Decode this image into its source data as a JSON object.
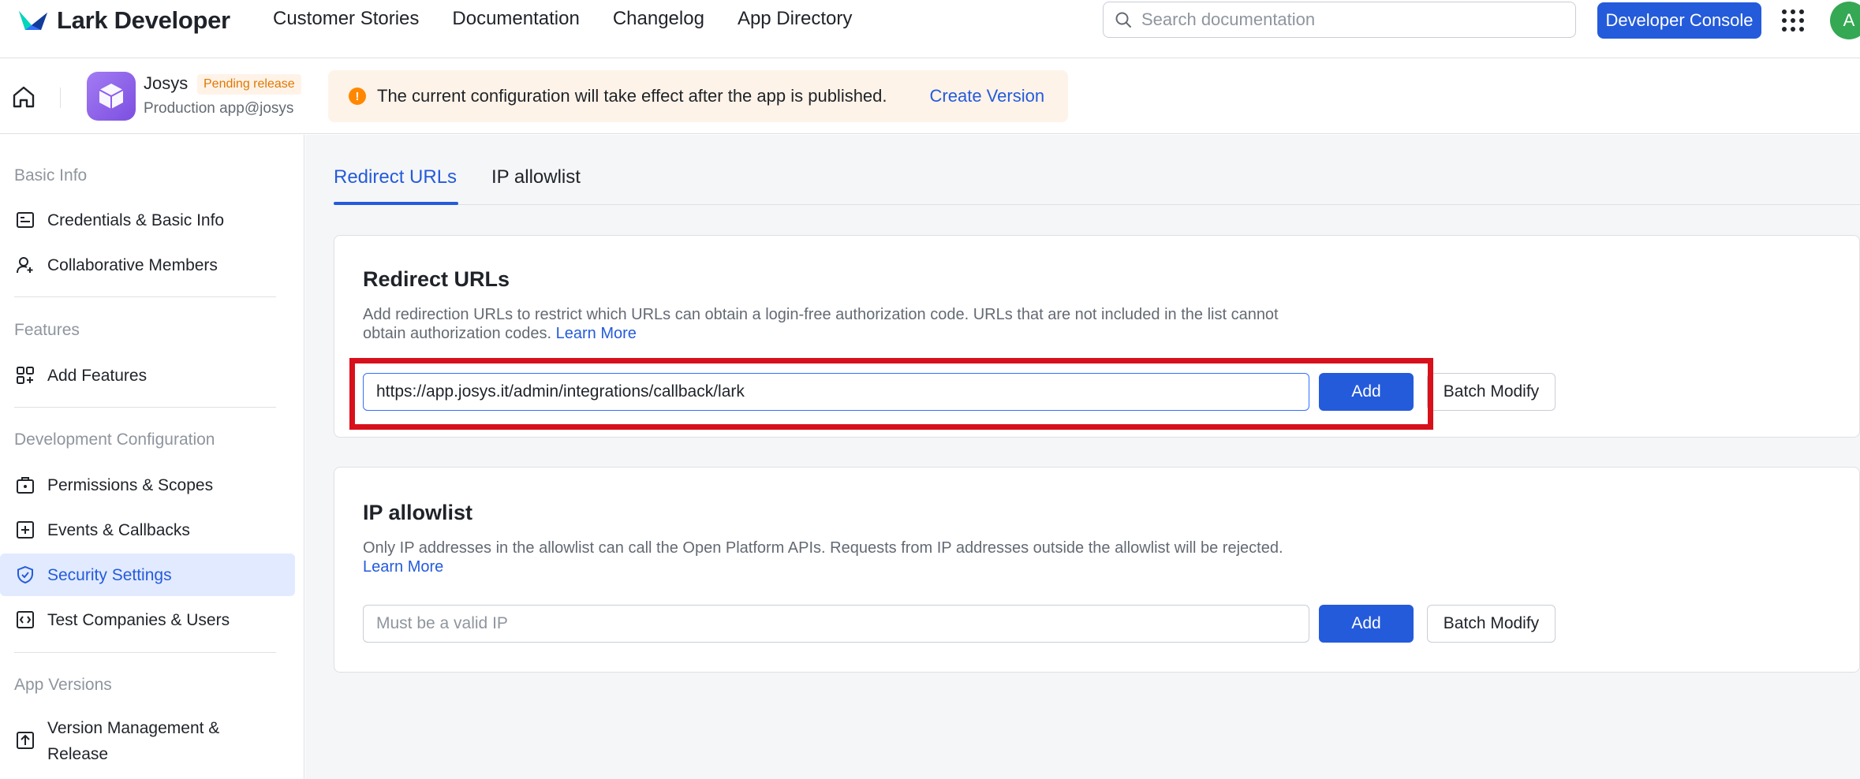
{
  "brand": {
    "name": "Lark Developer",
    "icon": "lark-logo-icon"
  },
  "nav": {
    "links": [
      "Customer Stories",
      "Documentation",
      "Changelog",
      "App Directory"
    ],
    "search_placeholder": "Search documentation",
    "developer_console": "Developer Console",
    "avatar_initial": "A"
  },
  "app": {
    "name": "Josys",
    "status": "Pending release",
    "subtitle": "Production app@josys",
    "notice": "The current configuration will take effect after the app is published.",
    "notice_action": "Create Version"
  },
  "sidebar": {
    "sections": [
      {
        "title": "Basic Info",
        "items": [
          {
            "label": "Credentials & Basic Info",
            "icon": "credentials-icon"
          },
          {
            "label": "Collaborative Members",
            "icon": "add-member-icon"
          }
        ]
      },
      {
        "title": "Features",
        "items": [
          {
            "label": "Add Features",
            "icon": "add-features-icon"
          }
        ]
      },
      {
        "title": "Development Configuration",
        "items": [
          {
            "label": "Permissions & Scopes",
            "icon": "permissions-icon"
          },
          {
            "label": "Events & Callbacks",
            "icon": "events-icon"
          },
          {
            "label": "Security Settings",
            "icon": "shield-icon",
            "active": true
          },
          {
            "label": "Test Companies & Users",
            "icon": "test-code-icon"
          }
        ]
      },
      {
        "title": "App Versions",
        "items": [
          {
            "label": "Version Management & Release",
            "icon": "upload-icon"
          }
        ]
      }
    ]
  },
  "tabs": [
    {
      "label": "Redirect URLs",
      "active": true
    },
    {
      "label": "IP allowlist",
      "active": false
    }
  ],
  "redirect": {
    "title": "Redirect URLs",
    "desc": "Add redirection URLs to restrict which URLs can obtain a login-free authorization code. URLs that are not included in the list cannot obtain authorization codes.",
    "learn_more": "Learn More",
    "input_value": "https://app.josys.it/admin/integrations/callback/lark",
    "add_label": "Add",
    "batch_label": "Batch Modify"
  },
  "ip": {
    "title": "IP allowlist",
    "desc": "Only IP addresses in the allowlist can call the Open Platform APIs. Requests from IP addresses outside the allowlist will be rejected.",
    "learn_more": "Learn More",
    "placeholder": "Must be a valid IP",
    "add_label": "Add",
    "batch_label": "Batch Modify"
  },
  "colors": {
    "accent": "#245bdb",
    "highlight": "#d8101b",
    "warning": "#ff8800"
  }
}
